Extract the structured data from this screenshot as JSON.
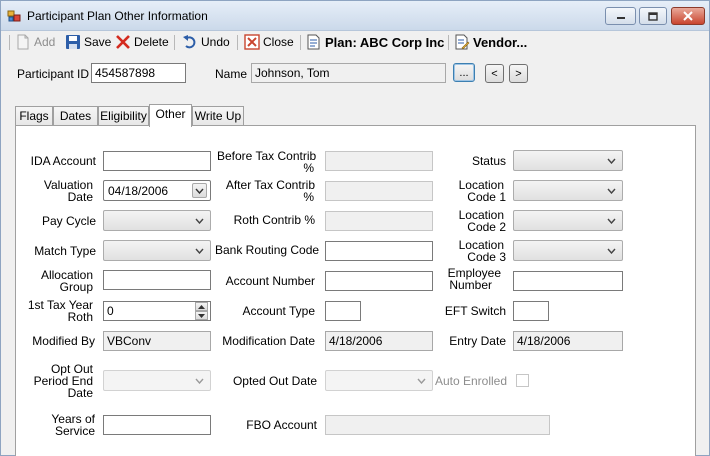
{
  "window": {
    "title": "Participant Plan Other Information"
  },
  "toolbar": {
    "add": "Add",
    "save": "Save",
    "delete": "Delete",
    "undo": "Undo",
    "close": "Close",
    "plan": "Plan: ABC Corp Inc",
    "vendor": "Vendor..."
  },
  "header": {
    "participant_id_label": "Participant ID",
    "participant_id": "454587898",
    "name_label": "Name",
    "name": "Johnson, Tom",
    "browse": "...",
    "prev": "<",
    "next": ">"
  },
  "tabs": [
    "Flags",
    "Dates",
    "Eligibility",
    "Other",
    "Write Up"
  ],
  "active_tab": "Other",
  "form": {
    "ida_account": {
      "label": "IDA Account",
      "value": ""
    },
    "valuation_date": {
      "label1": "Valuation",
      "label2": "Date",
      "value": "04/18/2006"
    },
    "pay_cycle": {
      "label": "Pay Cycle",
      "value": ""
    },
    "match_type": {
      "label": "Match Type",
      "value": ""
    },
    "allocation_group": {
      "label1": "Allocation",
      "label2": "Group",
      "value": ""
    },
    "first_tax_year_roth": {
      "label1": "1st Tax Year",
      "label2": "Roth",
      "value": "0"
    },
    "modified_by": {
      "label": "Modified By",
      "value": "VBConv"
    },
    "opt_out_period_end_date": {
      "label1": "Opt Out",
      "label2": "Period End",
      "label3": "Date",
      "value": ""
    },
    "years_of_service": {
      "label1": "Years of",
      "label2": "Service",
      "value": ""
    },
    "before_tax_contrib": {
      "label1": "Before Tax Contrib",
      "label2": "%",
      "value": ""
    },
    "after_tax_contrib": {
      "label1": "After Tax Contrib",
      "label2": "%",
      "value": ""
    },
    "roth_contrib": {
      "label": "Roth Contrib %",
      "value": ""
    },
    "bank_routing_code": {
      "label": "Bank Routing Code",
      "value": ""
    },
    "account_number": {
      "label": "Account Number",
      "value": ""
    },
    "account_type": {
      "label": "Account Type",
      "value": ""
    },
    "modification_date": {
      "label": "Modification Date",
      "value": "4/18/2006"
    },
    "opted_out_date": {
      "label": "Opted Out Date",
      "value": ""
    },
    "fbo_account": {
      "label": "FBO Account",
      "value": ""
    },
    "status": {
      "label": "Status",
      "value": ""
    },
    "location_code_1": {
      "label1": "Location",
      "label2": "Code 1",
      "value": ""
    },
    "location_code_2": {
      "label1": "Location",
      "label2": "Code 2",
      "value": ""
    },
    "location_code_3": {
      "label1": "Location",
      "label2": "Code 3",
      "value": ""
    },
    "employee_number": {
      "label1": "Employee",
      "label2": "Number",
      "value": ""
    },
    "eft_switch": {
      "label": "EFT Switch",
      "value": ""
    },
    "entry_date": {
      "label": "Entry Date",
      "value": "4/18/2006"
    },
    "auto_enrolled": {
      "label": "Auto Enrolled",
      "checked": false
    }
  },
  "colors": {
    "accent": "#3c7fb1",
    "close_button": "#c9452f",
    "panel": "#ffffff",
    "chrome": "#f0f0f0"
  }
}
